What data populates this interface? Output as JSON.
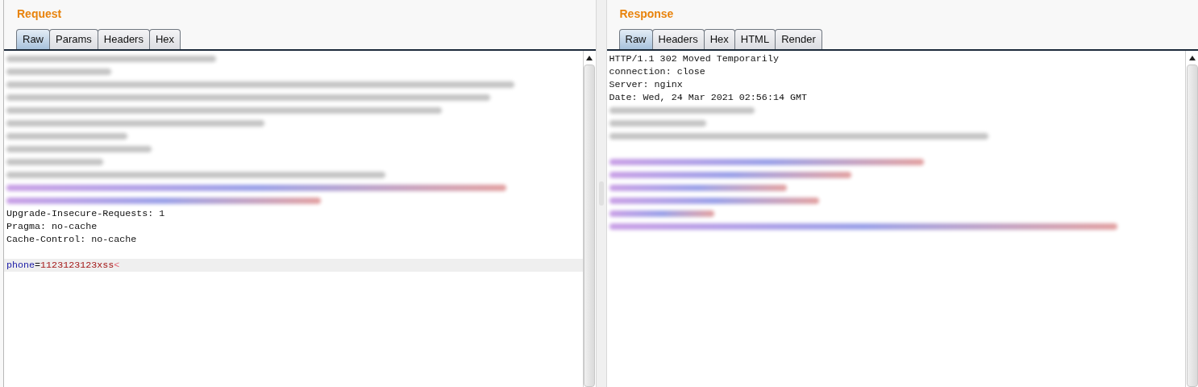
{
  "panels": [
    {
      "title": "Request",
      "tabs": [
        {
          "label": "Raw",
          "selected": true
        },
        {
          "label": "Params",
          "selected": false
        },
        {
          "label": "Headers",
          "selected": false
        },
        {
          "label": "Hex",
          "selected": false
        }
      ],
      "lines": [
        {
          "kind": "redacted"
        },
        {
          "kind": "redacted"
        },
        {
          "kind": "redacted"
        },
        {
          "kind": "redacted"
        },
        {
          "kind": "redacted"
        },
        {
          "kind": "redacted"
        },
        {
          "kind": "redacted"
        },
        {
          "kind": "redacted"
        },
        {
          "kind": "redacted"
        },
        {
          "kind": "redacted"
        },
        {
          "kind": "redacted-markup"
        },
        {
          "kind": "redacted-markup"
        },
        {
          "kind": "text",
          "text": "Upgrade-Insecure-Requests: 1"
        },
        {
          "kind": "text",
          "text": "Pragma: no-cache"
        },
        {
          "kind": "text",
          "text": "Cache-Control: no-cache"
        },
        {
          "kind": "blank"
        },
        {
          "kind": "param",
          "selected": true,
          "name": "phone",
          "sep": "=",
          "value": "1123123123xss",
          "tail": "<"
        }
      ]
    },
    {
      "title": "Response",
      "tabs": [
        {
          "label": "Raw",
          "selected": true
        },
        {
          "label": "Headers",
          "selected": false
        },
        {
          "label": "Hex",
          "selected": false
        },
        {
          "label": "HTML",
          "selected": false
        },
        {
          "label": "Render",
          "selected": false
        }
      ],
      "lines": [
        {
          "kind": "text",
          "text": "HTTP/1.1 302 Moved Temporarily"
        },
        {
          "kind": "text",
          "text": "connection: close"
        },
        {
          "kind": "text",
          "text": "Server: nginx"
        },
        {
          "kind": "text",
          "text": "Date: Wed, 24 Mar 2021 02:56:14 GMT"
        },
        {
          "kind": "redacted"
        },
        {
          "kind": "redacted"
        },
        {
          "kind": "redacted"
        },
        {
          "kind": "blank"
        },
        {
          "kind": "redacted-markup"
        },
        {
          "kind": "redacted-markup"
        },
        {
          "kind": "redacted-markup"
        },
        {
          "kind": "redacted-markup"
        },
        {
          "kind": "redacted-markup"
        },
        {
          "kind": "redacted-markup"
        }
      ]
    }
  ]
}
